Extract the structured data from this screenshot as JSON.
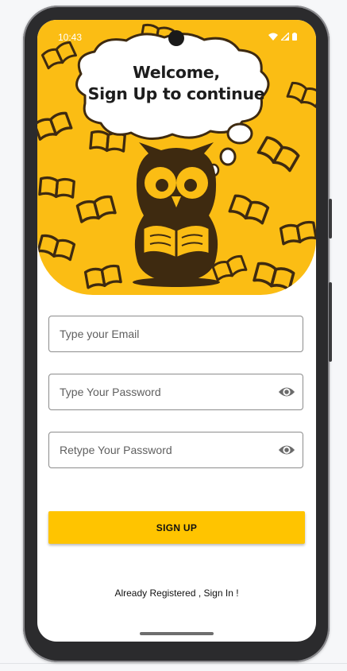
{
  "status_bar": {
    "time": "10:43"
  },
  "hero": {
    "bubble_line1": "Welcome,",
    "bubble_line2": "Sign Up to continue"
  },
  "form": {
    "email_placeholder": "Type your Email",
    "password_placeholder": "Type Your Password",
    "retype_placeholder": "Retype Your Password",
    "signup_label": "SIGN UP"
  },
  "footer": {
    "signin_text": "Already Registered , Sign In !"
  },
  "colors": {
    "accent": "#ffc400",
    "hero_bg": "#fbbd14",
    "owl": "#3e2a10"
  },
  "icons": [
    "wifi-icon",
    "signal-icon",
    "battery-icon",
    "eye-icon"
  ]
}
